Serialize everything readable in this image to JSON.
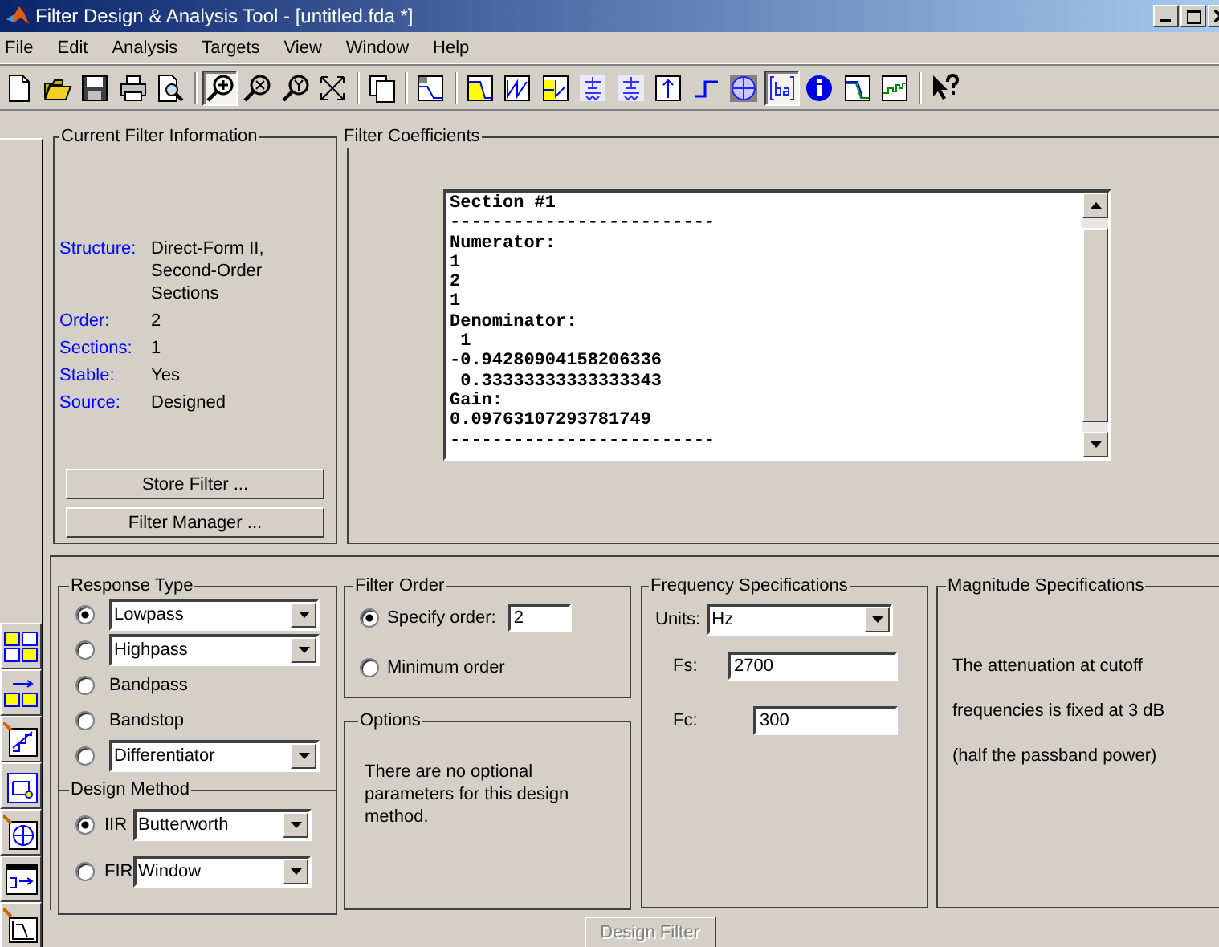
{
  "window": {
    "title": "Filter Design & Analysis Tool -  [untitled.fda *]"
  },
  "menu": [
    {
      "label": "File"
    },
    {
      "label": "Edit"
    },
    {
      "label": "Analysis"
    },
    {
      "label": "Targets"
    },
    {
      "label": "View"
    },
    {
      "label": "Window"
    },
    {
      "label": "Help"
    }
  ],
  "toolbar": [
    {
      "kind": "new",
      "selected": false
    },
    {
      "kind": "open",
      "selected": false
    },
    {
      "kind": "save",
      "selected": false
    },
    {
      "kind": "print",
      "selected": false
    },
    {
      "kind": "preview",
      "selected": false
    },
    {
      "kind": "separator"
    },
    {
      "kind": "zoom_in",
      "selected": true
    },
    {
      "kind": "zoom_x",
      "selected": false
    },
    {
      "kind": "zoom_y",
      "selected": false
    },
    {
      "kind": "full_view",
      "selected": false
    },
    {
      "kind": "separator"
    },
    {
      "kind": "new_window",
      "selected": false
    },
    {
      "kind": "separator"
    },
    {
      "kind": "analysis_params",
      "selected": false
    },
    {
      "kind": "separator"
    },
    {
      "kind": "magnitude",
      "selected": false
    },
    {
      "kind": "phase",
      "selected": false
    },
    {
      "kind": "mag_phase",
      "selected": false
    },
    {
      "kind": "group_delay",
      "selected": false
    },
    {
      "kind": "phase_delay",
      "selected": false
    },
    {
      "kind": "impulse",
      "selected": false
    },
    {
      "kind": "step",
      "selected": false
    },
    {
      "kind": "pole_zero",
      "selected": false
    },
    {
      "kind": "coefficients",
      "selected": true
    },
    {
      "kind": "info",
      "selected": false
    },
    {
      "kind": "mag_estimate",
      "selected": false
    },
    {
      "kind": "roundoff",
      "selected": false
    },
    {
      "kind": "separator"
    },
    {
      "kind": "whats_this",
      "selected": false
    }
  ],
  "sidebar_tools": [
    {
      "kind": "transform"
    },
    {
      "kind": "convert"
    },
    {
      "kind": "quantize"
    },
    {
      "kind": "realize"
    },
    {
      "kind": "pole_zero"
    },
    {
      "kind": "import"
    },
    {
      "kind": "design"
    }
  ],
  "current_filter": {
    "title": "Current Filter Information",
    "fields": [
      {
        "label": "Structure:",
        "value": "Direct-Form II, Second-Order Sections"
      },
      {
        "label": "Order:",
        "value": "2"
      },
      {
        "label": "Sections:",
        "value": "1"
      },
      {
        "label": "Stable:",
        "value": "Yes"
      },
      {
        "label": "Source:",
        "value": "Designed"
      }
    ],
    "buttons": [
      "Store Filter ...",
      "Filter Manager ..."
    ]
  },
  "coefficients": {
    "title": "Filter Coefficients",
    "lines": [
      "Section #1",
      "-------------------------",
      "Numerator:",
      "1",
      "2",
      "1",
      "Denominator:",
      " 1",
      "-0.94280904158206336",
      " 0.33333333333333343",
      "Gain:",
      "0.09763107293781749",
      "-------------------------"
    ]
  },
  "response_type": {
    "title": "Response Type",
    "options": [
      {
        "kind": "dropdown",
        "label": "Lowpass",
        "selected": true
      },
      {
        "kind": "dropdown",
        "label": "Highpass",
        "selected": false
      },
      {
        "kind": "radio",
        "label": "Bandpass",
        "selected": false
      },
      {
        "kind": "radio",
        "label": "Bandstop",
        "selected": false
      },
      {
        "kind": "dropdown",
        "label": "Differentiator",
        "selected": false
      }
    ]
  },
  "design_method": {
    "title": "Design Method",
    "options": [
      {
        "label": "IIR",
        "value": "Butterworth",
        "selected": true
      },
      {
        "label": "FIR",
        "value": "Window",
        "selected": false
      }
    ]
  },
  "filter_order": {
    "title": "Filter Order",
    "options": [
      {
        "label": "Specify order:",
        "value": "2",
        "selected": true
      },
      {
        "label": "Minimum order",
        "selected": false
      }
    ]
  },
  "options": {
    "title": "Options",
    "text": "There are no optional parameters for this design method."
  },
  "frequency_specifications": {
    "title": "Frequency Specifications",
    "units": {
      "label": "Units:",
      "value": "Hz"
    },
    "fields": [
      {
        "label": "Fs:",
        "value": "2700"
      },
      {
        "label": "Fc:",
        "value": "300"
      }
    ]
  },
  "magnitude_specifications": {
    "title": "Magnitude Specifications",
    "lines": [
      "The attenuation at cutoff",
      "frequencies is fixed at 3 dB",
      "(half the passband power)"
    ]
  },
  "design_button": {
    "label": "Design Filter",
    "disabled": true
  }
}
